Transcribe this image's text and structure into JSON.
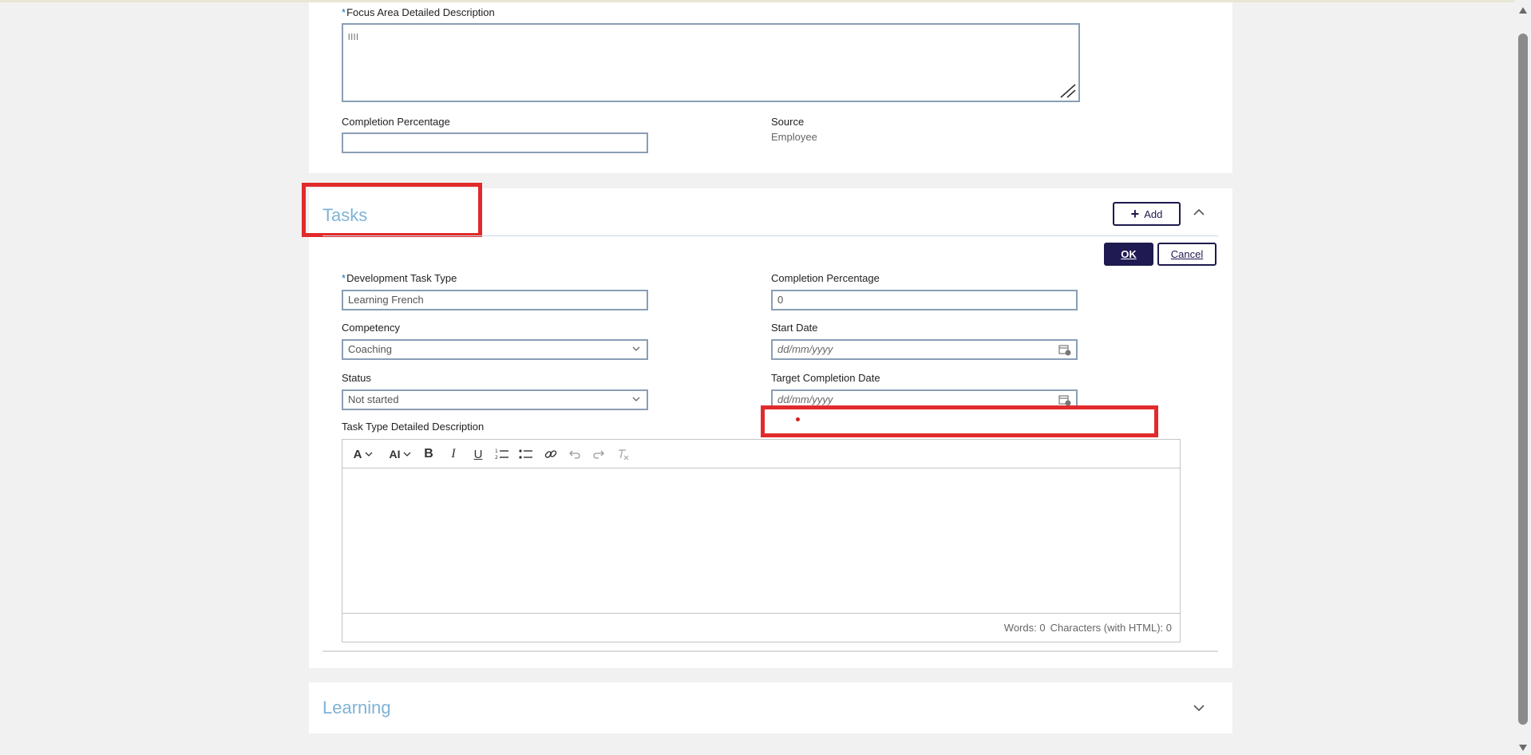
{
  "focus_area": {
    "description_label": "Focus Area Detailed Description",
    "description_required": "*",
    "description_value": "llll",
    "completion_label": "Completion Percentage",
    "completion_value": "",
    "source_label": "Source",
    "source_value": "Employee"
  },
  "tasks": {
    "title": "Tasks",
    "add_label": "Add",
    "ok_label": "OK",
    "cancel_label": "Cancel",
    "dev_task_type_label": "Development Task Type",
    "dev_task_type_required": "*",
    "dev_task_type_value": "Learning French",
    "completion_label": "Completion Percentage",
    "completion_value": "0",
    "competency_label": "Competency",
    "competency_value": "Coaching",
    "start_date_label": "Start Date",
    "start_date_placeholder": "dd/mm/yyyy",
    "status_label": "Status",
    "status_value": "Not started",
    "target_date_label": "Target Completion Date",
    "target_date_placeholder": "dd/mm/yyyy",
    "task_desc_label": "Task Type Detailed Description",
    "editor": {
      "toolbar": {
        "font_family": "A",
        "font_size": "AI",
        "bold": "B",
        "italic": "I",
        "underline": "U"
      },
      "footer_words": "Words: 0",
      "footer_chars": "Characters (with HTML): 0"
    }
  },
  "learning": {
    "title": "Learning"
  },
  "colors": {
    "accent": "#201a52",
    "section_title": "#7fb3d5",
    "highlight": "#e12a2b",
    "input_border": "#8a9eb5"
  }
}
